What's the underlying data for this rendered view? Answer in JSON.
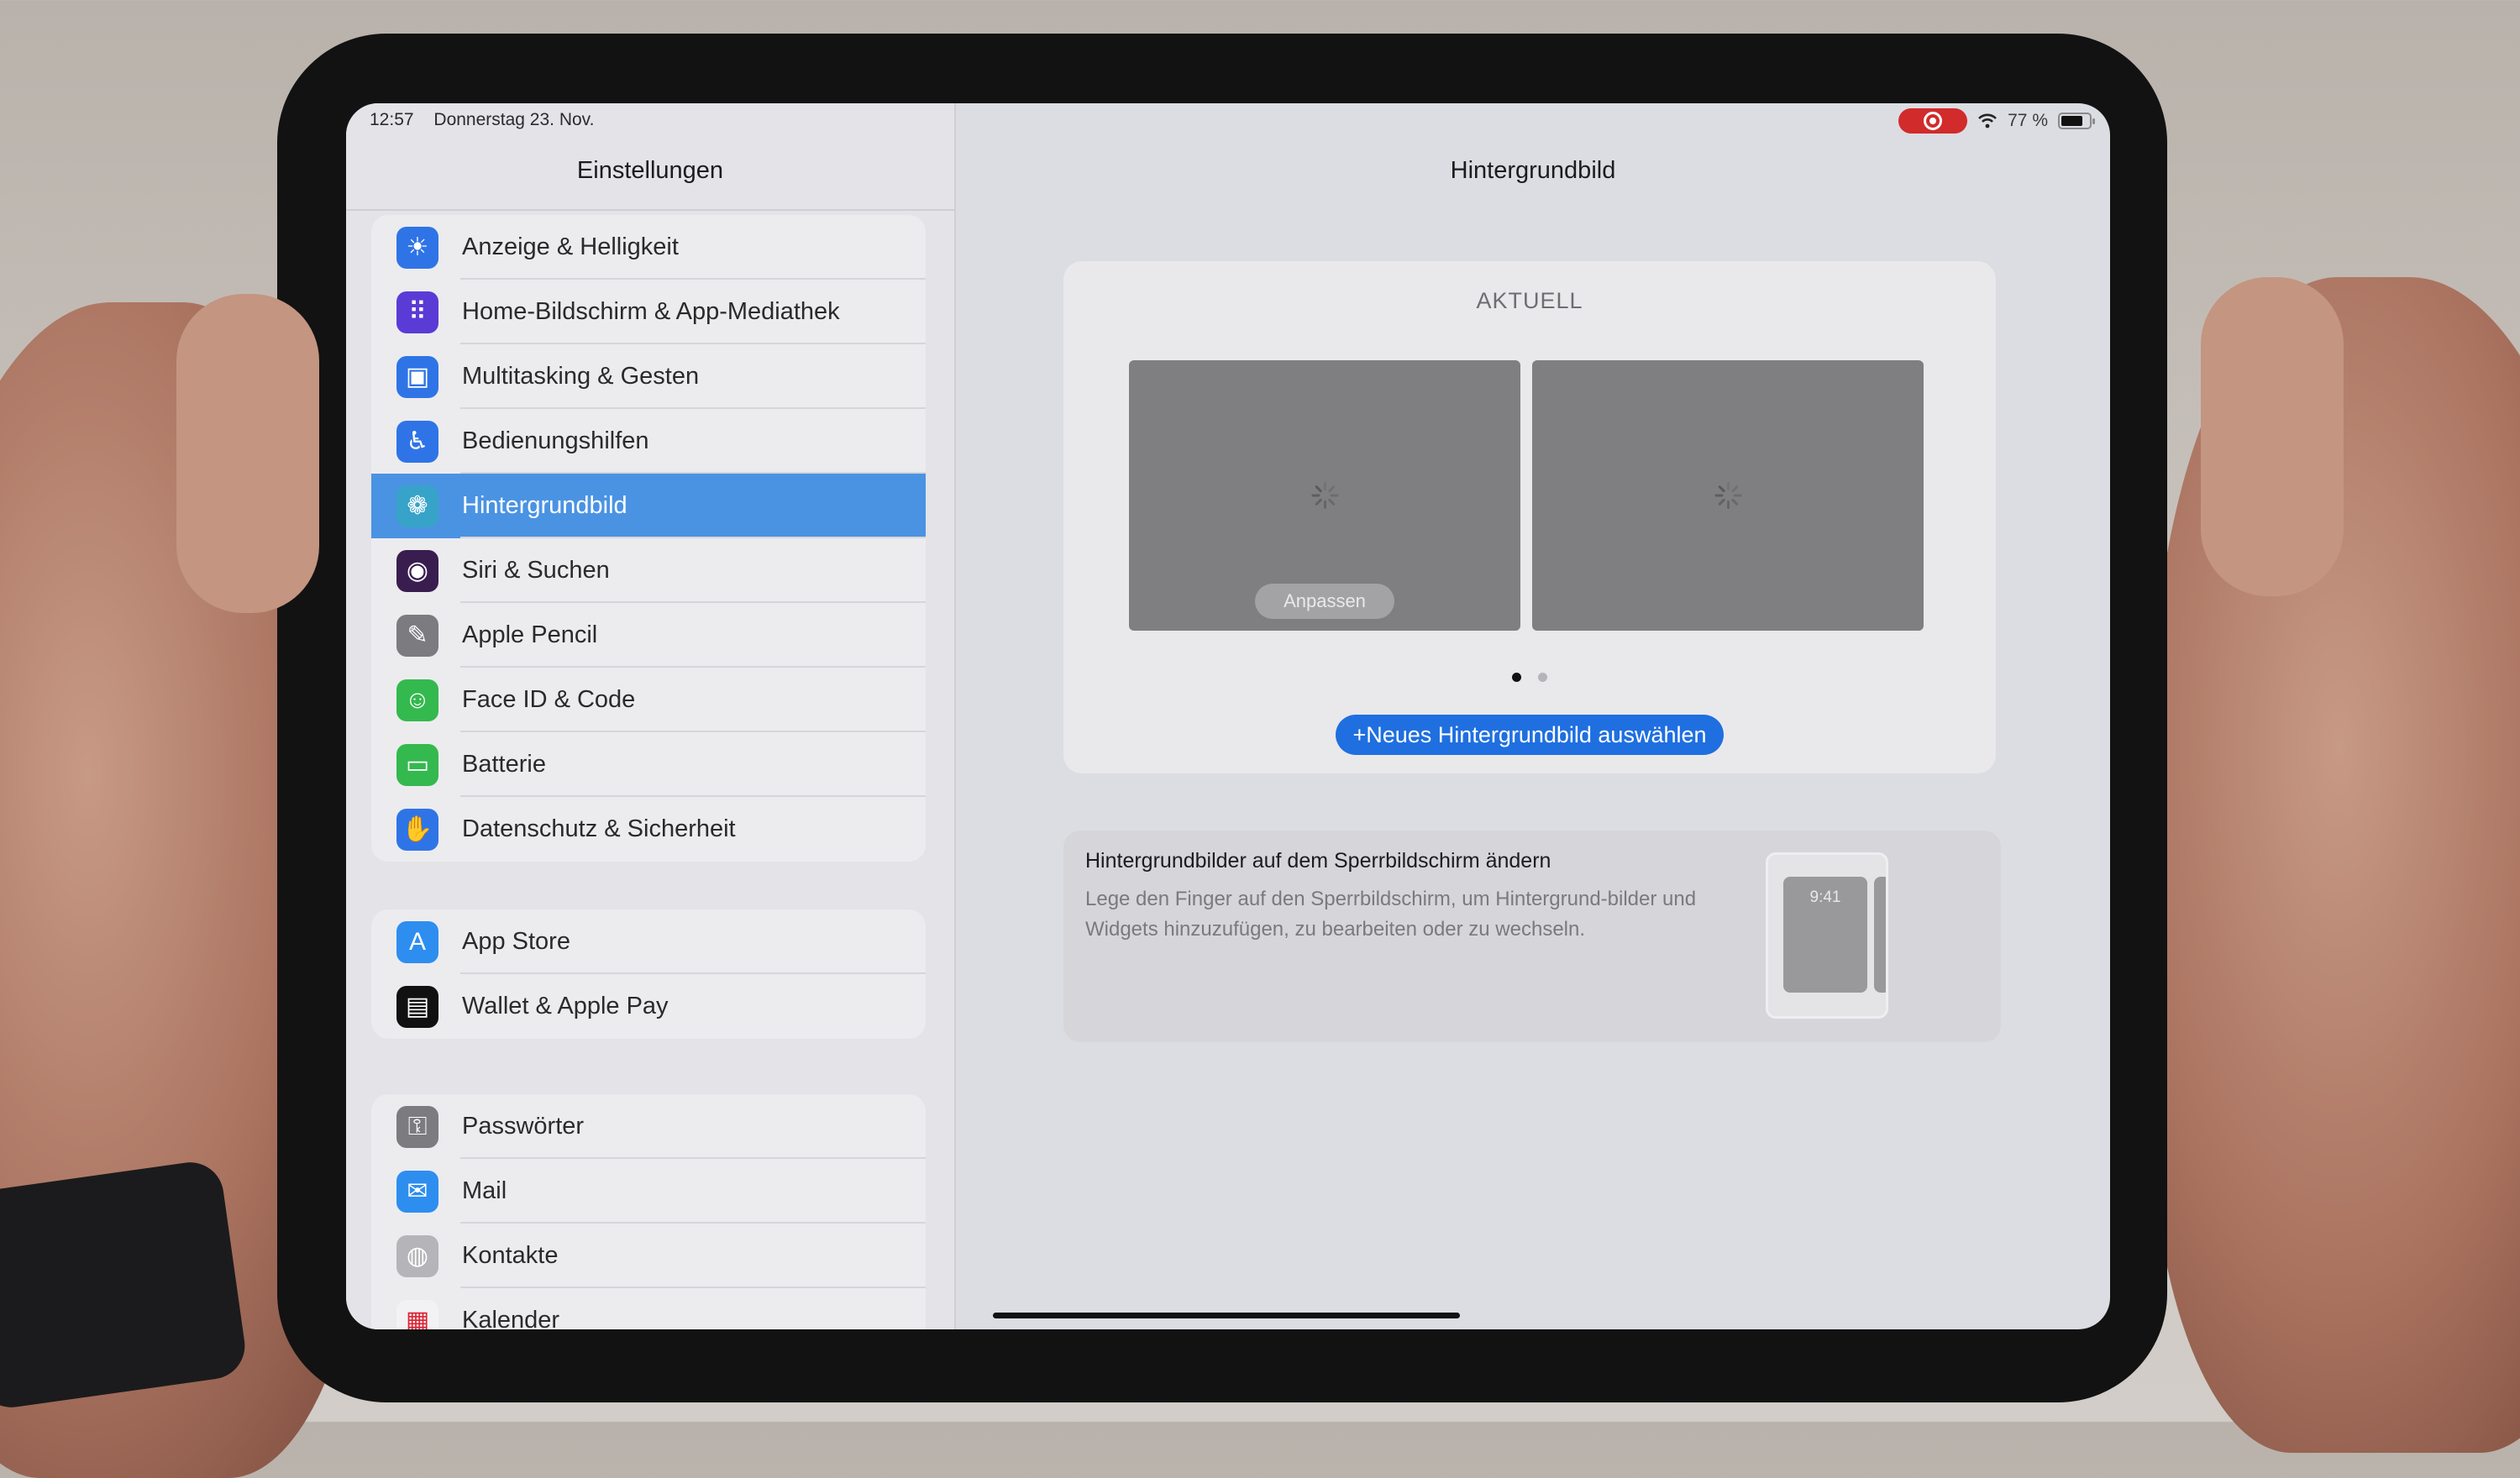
{
  "status_bar": {
    "time": "12:57",
    "date": "Donnerstag 23. Nov.",
    "battery_percent": "77 %",
    "battery_level": 0.77,
    "recording_indicator": "screen-recording-icon",
    "wifi_icon": "wifi-icon"
  },
  "sidebar": {
    "title": "Einstellungen",
    "groups": [
      {
        "items": [
          {
            "label": "Anzeige & Helligkeit",
            "icon": "sun-icon",
            "color": "#2f74e6",
            "glyph": "☀"
          },
          {
            "label": "Home-Bildschirm & App-Mediathek",
            "icon": "app-grid-icon",
            "color": "#5b3bd6",
            "glyph": "⠿"
          },
          {
            "label": "Multitasking & Gesten",
            "icon": "multitasking-icon",
            "color": "#2f74e6",
            "glyph": "▣"
          },
          {
            "label": "Bedienungshilfen",
            "icon": "accessibility-icon",
            "color": "#2f74e6",
            "glyph": "♿"
          },
          {
            "label": "Hintergrundbild",
            "icon": "wallpaper-flower-icon",
            "color": "#37a3c8",
            "glyph": "❁",
            "selected": true
          },
          {
            "label": "Siri & Suchen",
            "icon": "siri-icon",
            "color": "#3a1d4f",
            "glyph": "◉"
          },
          {
            "label": "Apple Pencil",
            "icon": "pencil-icon",
            "color": "#7b7b80",
            "glyph": "✎"
          },
          {
            "label": "Face ID & Code",
            "icon": "face-id-icon",
            "color": "#34b94e",
            "glyph": "☺"
          },
          {
            "label": "Batterie",
            "icon": "battery-icon",
            "color": "#34b94e",
            "glyph": "▭"
          },
          {
            "label": "Datenschutz & Sicherheit",
            "icon": "hand-icon",
            "color": "#2f74e6",
            "glyph": "✋"
          }
        ]
      },
      {
        "items": [
          {
            "label": "App Store",
            "icon": "app-store-icon",
            "color": "#2d8ef0",
            "glyph": "A"
          },
          {
            "label": "Wallet & Apple Pay",
            "icon": "wallet-icon",
            "color": "#111111",
            "glyph": "▤"
          }
        ]
      },
      {
        "items": [
          {
            "label": "Passwörter",
            "icon": "key-icon",
            "color": "#7b7b80",
            "glyph": "⚿"
          },
          {
            "label": "Mail",
            "icon": "mail-icon",
            "color": "#2d8ef0",
            "glyph": "✉"
          },
          {
            "label": "Kontakte",
            "icon": "contacts-icon",
            "color": "#b5b5b9",
            "glyph": "◍"
          },
          {
            "label": "Kalender",
            "icon": "calendar-icon",
            "color": "#f2f2f4",
            "glyph": "▦"
          }
        ]
      }
    ]
  },
  "detail": {
    "title": "Hintergrundbild",
    "current_section": {
      "header": "AKTUELL",
      "customize_label": "Anpassen",
      "page_count": 2,
      "current_page": 1,
      "new_wallpaper_button": "+Neues Hintergrundbild auswählen"
    },
    "info_card": {
      "title": "Hintergrundbilder auf dem Sperrbildschirm ändern",
      "body": "Lege den Finger auf den Sperrbildschirm, um Hintergrund-bilder und Widgets hinzuzufügen, zu bearbeiten oder zu wechseln.",
      "preview_time": "9:41"
    }
  },
  "colors": {
    "accent": "#1f6fe0",
    "selected_row": "#4a93e3",
    "recording": "#d12b2b"
  }
}
